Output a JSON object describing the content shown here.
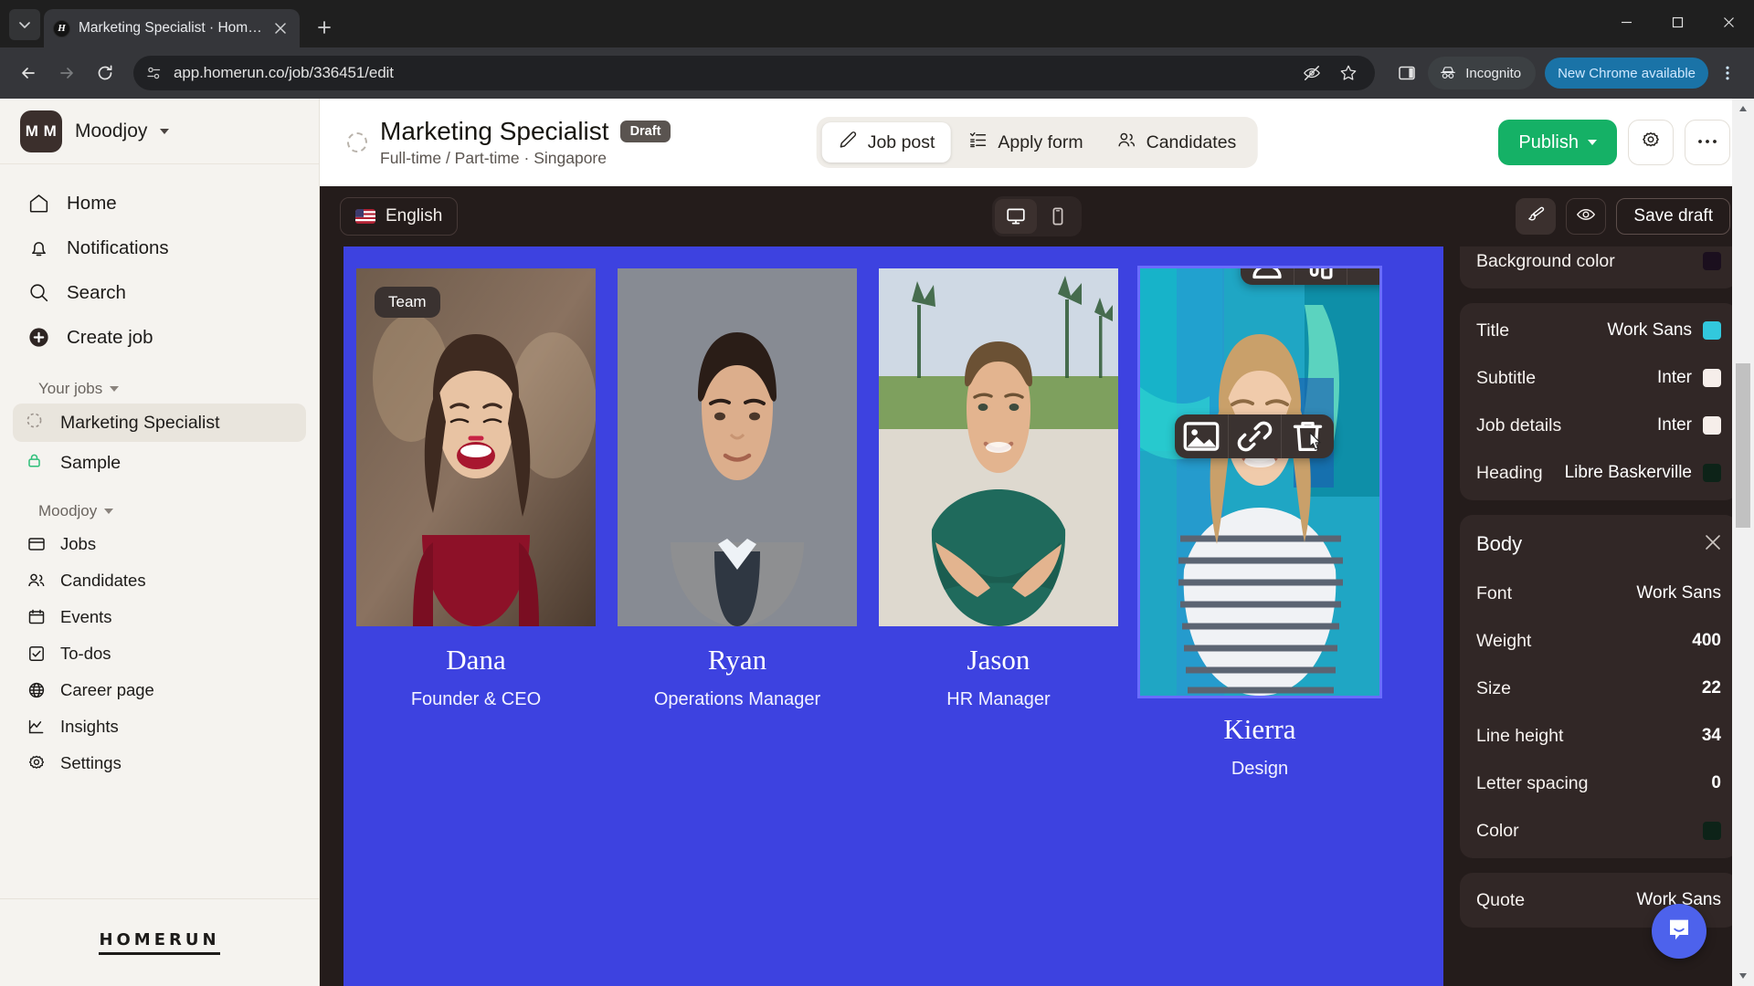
{
  "browser": {
    "tab": {
      "title": "Marketing Specialist · Homerun",
      "favicon_letter": "H"
    },
    "new_tab_label": "+",
    "url": "app.homerun.co/job/336451/edit",
    "incognito_label": "Incognito",
    "update_label": "New Chrome available"
  },
  "sidebar": {
    "org": {
      "initials": "M M",
      "name": "Moodjoy"
    },
    "nav": [
      {
        "label": "Home",
        "icon": "home-icon"
      },
      {
        "label": "Notifications",
        "icon": "bell-icon"
      },
      {
        "label": "Search",
        "icon": "search-icon"
      },
      {
        "label": "Create job",
        "icon": "plus-circle-icon"
      }
    ],
    "your_jobs_label": "Your jobs",
    "jobs": [
      {
        "label": "Marketing Specialist",
        "icon": "draft-spinner-icon",
        "selected": true
      },
      {
        "label": "Sample",
        "icon": "lock-icon",
        "selected": false
      }
    ],
    "workspace_label": "Moodjoy",
    "workspace_items": [
      {
        "label": "Jobs",
        "icon": "jobs-icon"
      },
      {
        "label": "Candidates",
        "icon": "candidates-icon"
      },
      {
        "label": "Events",
        "icon": "calendar-icon"
      },
      {
        "label": "To-dos",
        "icon": "checkbox-icon"
      },
      {
        "label": "Career page",
        "icon": "globe-icon"
      },
      {
        "label": "Insights",
        "icon": "chart-line-icon"
      },
      {
        "label": "Settings",
        "icon": "gear-icon"
      }
    ],
    "footer_logo": "HOMERUN"
  },
  "header": {
    "job_title": "Marketing Specialist",
    "status_badge": "Draft",
    "subtitle": "Full-time / Part-time · Singapore",
    "tabs": [
      {
        "label": "Job post",
        "icon": "pencil-icon",
        "active": true
      },
      {
        "label": "Apply form",
        "icon": "form-list-icon",
        "active": false
      },
      {
        "label": "Candidates",
        "icon": "people-icon",
        "active": false
      }
    ],
    "publish_label": "Publish",
    "settings_icon": "gear-icon",
    "more_icon": "ellipsis-icon"
  },
  "editor_bar": {
    "language": "English",
    "language_flag": "us-flag-icon",
    "devices": [
      {
        "name": "desktop-icon",
        "active": true
      },
      {
        "name": "mobile-icon",
        "active": false
      }
    ],
    "brush_icon": "brush-icon",
    "preview_icon": "eye-icon",
    "save_draft_label": "Save draft"
  },
  "canvas": {
    "background_color": "#3d42e0",
    "section_chip": "Team",
    "members": [
      {
        "name": "Dana",
        "role": "Founder & CEO",
        "selected": false
      },
      {
        "name": "Ryan",
        "role": "Operations Manager",
        "selected": false
      },
      {
        "name": "Jason",
        "role": "HR Manager",
        "selected": false
      },
      {
        "name": "Kierra",
        "role": "Design",
        "selected": true
      }
    ],
    "block_toolbar": [
      {
        "name": "person-block-icon"
      },
      {
        "name": "style-pencil-icon",
        "badge": true
      },
      {
        "name": "ellipsis-icon"
      }
    ],
    "image_toolbar": [
      {
        "name": "image-icon"
      },
      {
        "name": "link-icon"
      },
      {
        "name": "trash-icon"
      }
    ]
  },
  "settings_panel": {
    "background": {
      "label": "Background color",
      "swatch": "#1b0f1e"
    },
    "typography": [
      {
        "label": "Title",
        "value": "Work Sans",
        "swatch": "#32c8dd"
      },
      {
        "label": "Subtitle",
        "value": "Inter",
        "swatch": "#f6eeea"
      },
      {
        "label": "Job details",
        "value": "Inter",
        "swatch": "#f6eeea"
      },
      {
        "label": "Heading",
        "value": "Libre Baskerville",
        "swatch": "#0d2318"
      }
    ],
    "body": {
      "title": "Body",
      "close_icon": "close-icon",
      "rows": [
        {
          "label": "Font",
          "value": "Work Sans"
        },
        {
          "label": "Weight",
          "value": "400"
        },
        {
          "label": "Size",
          "value": "22"
        },
        {
          "label": "Line height",
          "value": "34"
        },
        {
          "label": "Letter spacing",
          "value": "0"
        },
        {
          "label": "Color",
          "value": "",
          "swatch": "#0d2318"
        }
      ]
    },
    "quote": {
      "label": "Quote",
      "value": "Work Sans"
    }
  },
  "chat_widget": {
    "icon": "intercom-chat-icon"
  }
}
